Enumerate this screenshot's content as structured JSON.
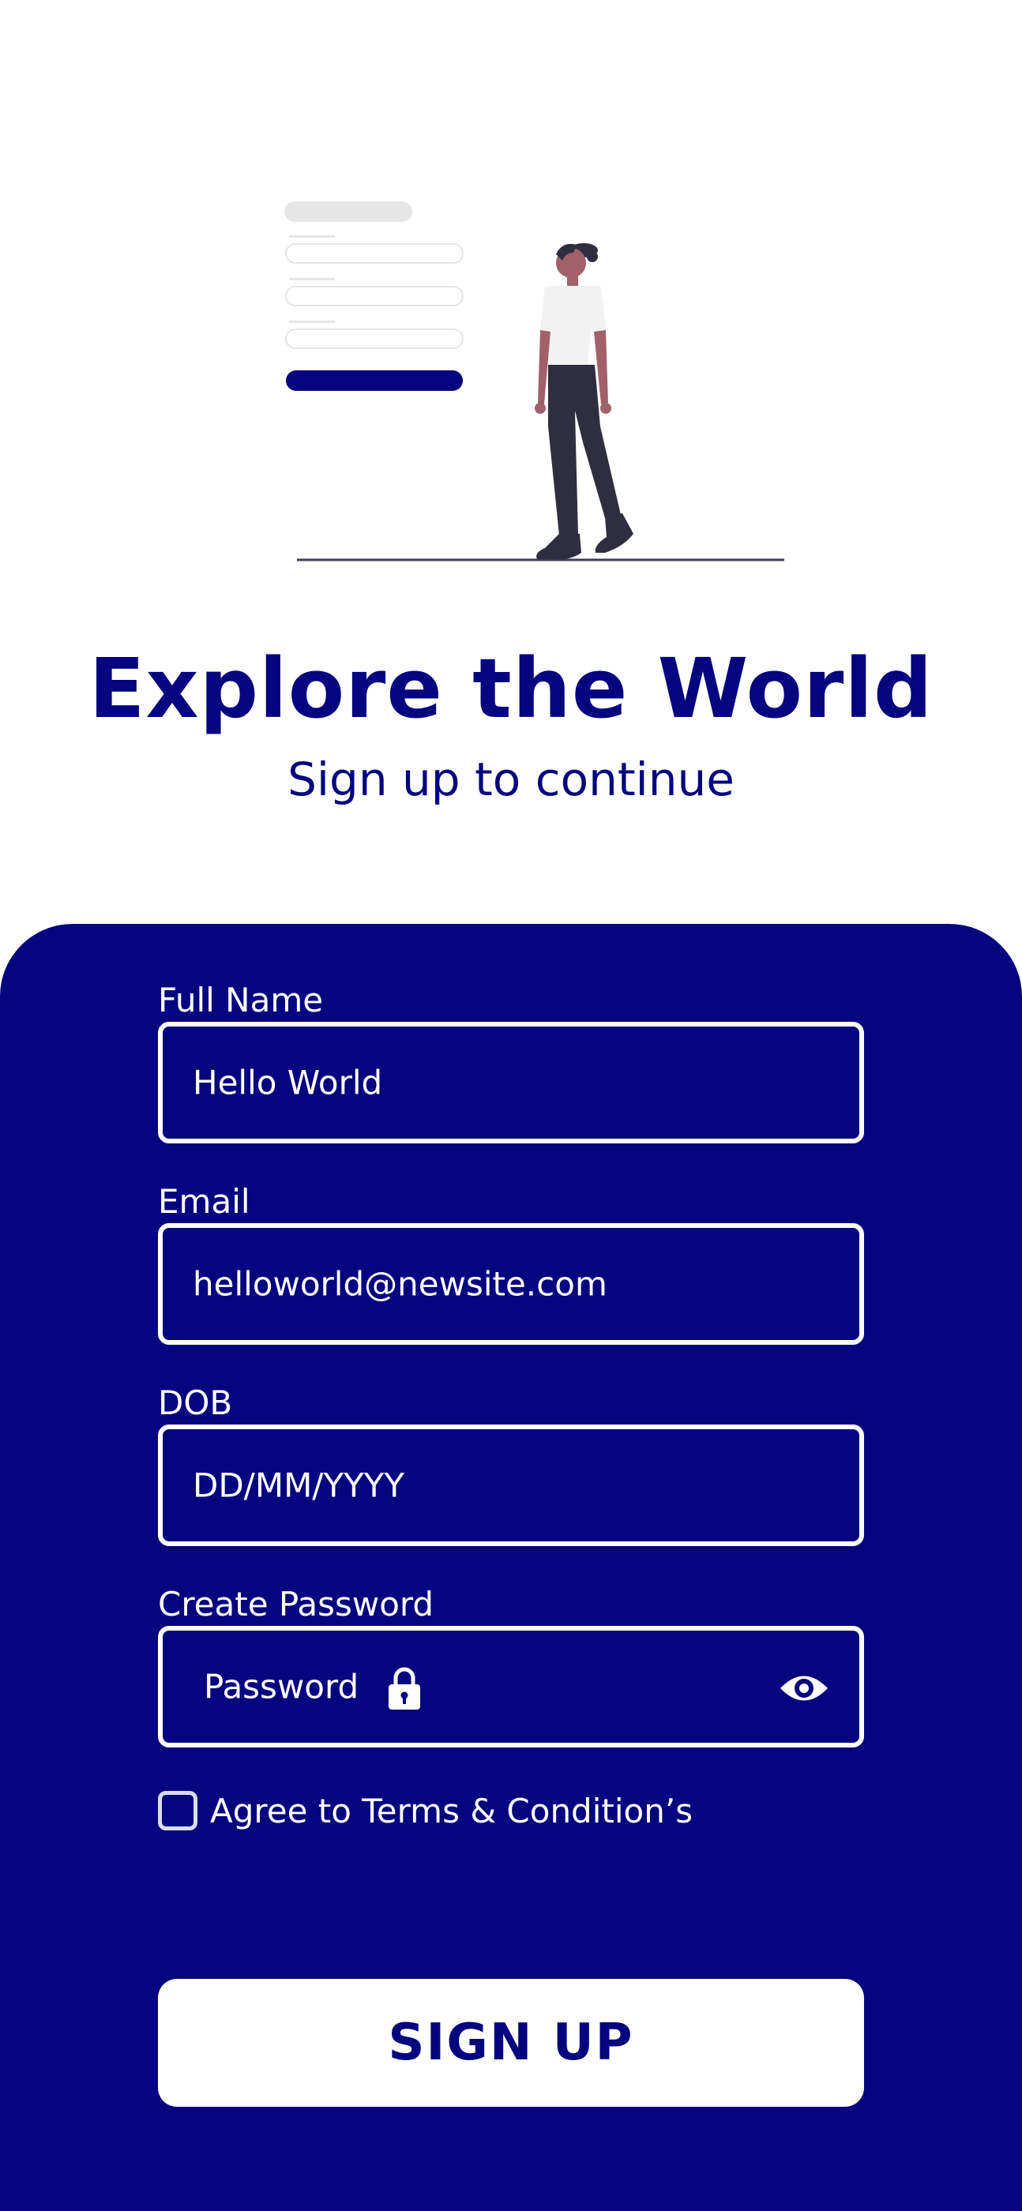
{
  "colors": {
    "primary": "#05057f",
    "surface": "#ffffff",
    "skin": "#a0616a",
    "dark": "#2f2e41"
  },
  "header": {
    "title": "Explore the World",
    "subtitle": "Sign up to continue"
  },
  "form": {
    "full_name": {
      "label": "Full Name",
      "value": "Hello World"
    },
    "email": {
      "label": "Email",
      "value": "helloworld@newsite.com"
    },
    "dob": {
      "label": "DOB",
      "placeholder": "DD/MM/YYYY"
    },
    "password": {
      "label": "Create Password",
      "placeholder": "Password",
      "icons": [
        "lock-icon",
        "eye-icon"
      ]
    },
    "terms": {
      "label": "Agree to Terms & Condition’s",
      "checked": false
    },
    "submit_label": "SIGN UP"
  }
}
